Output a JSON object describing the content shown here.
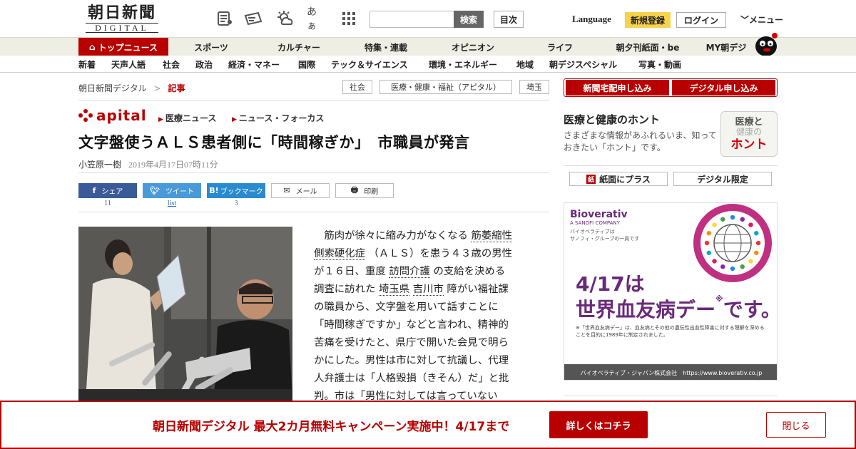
{
  "header": {
    "logo_kanji": "朝日新聞",
    "logo_sub": "DIGITAL",
    "search_placeholder": "",
    "search_button": "検索",
    "toc_button": "目次",
    "language": "Language",
    "register": "新規登録",
    "login": "ログイン",
    "menu": "メニュー",
    "font_size_glyph": "あぁ"
  },
  "nav_main": [
    "トップニュース",
    "スポーツ",
    "カルチャー",
    "特集・連載",
    "オピニオン",
    "ライフ",
    "朝夕刊紙面・be",
    "MY朝デジ"
  ],
  "nav_sub": [
    "新着",
    "天声人語",
    "社会",
    "政治",
    "経済・マネー",
    "国際",
    "テック＆サイエンス",
    "環境・エネルギー",
    "地域",
    "朝デジスペシャル",
    "写真・動画"
  ],
  "breadcrumb": {
    "home": "朝日新聞デジタル",
    "sep": ">",
    "current": "記事"
  },
  "tags": [
    "社会",
    "医療・健康・福祉（アピタル）",
    "埼玉"
  ],
  "article": {
    "brand": "apital",
    "categories": [
      "医療ニュース",
      "ニュース・フォーカス"
    ],
    "headline": "文字盤使うＡＬＳ患者側に「時間稼ぎか」　市職員が発言",
    "author": "小笠原一樹",
    "date": "2019年4月17日07時11分",
    "share": {
      "facebook": "シェア",
      "facebook_count": "11",
      "twitter": "ツイート",
      "twitter_count": "list",
      "hatena": "ブックマーク",
      "hatena_count": "3",
      "mail": "メール",
      "print": "印刷"
    },
    "body_lines": [
      [
        "　筋肉が徐々に縮み力がなくなる ",
        {
          "link": "筋萎縮性"
        }
      ],
      [
        {
          "link": "側索硬化症"
        },
        " （ＡＬＳ）を患う４３歳の男性"
      ],
      [
        "が１６日、重度 ",
        {
          "link": "訪問介護"
        },
        " の支給を決める"
      ],
      [
        "調査に訪れた ",
        {
          "link": "埼玉県"
        },
        " ",
        {
          "link": "吉川市"
        },
        " 障がい福祉課"
      ],
      [
        "の職員から、文字盤を用いて話すことに"
      ],
      [
        "「時間稼ぎですか」などと言われ、精神的"
      ],
      [
        "苦痛を受けたと、県庁で開いた会見で明ら"
      ],
      [
        "かにした。男性は市に対して抗議し、代理"
      ],
      [
        "人弁護士は「人格毀損（きそん）だ」と批"
      ],
      [
        "判。市は「男性に対しては言っていない"
      ]
    ]
  },
  "sidebar": {
    "btn_home_delivery": "新聞宅配申し込み",
    "btn_digital": "デジタル申し込み",
    "hontou_title": "医療と健康のホント",
    "hontou_desc": "さまざまな情報があふれるいま、知っておきたい「ホント」です。",
    "hontou_logo_1": "医療と",
    "hontou_logo_2": "健康の",
    "hontou_logo_3": "ホント",
    "btn_paper_plus": "紙面にプラス",
    "btn_digital_only": "デジタル限定"
  },
  "ad": {
    "brand": "Bioverativ",
    "brand_sub": "A SANOFI COMPANY",
    "brand_note": "バイオベラティブは\nサノフィ・グループの一員です",
    "ring_text": "WORLD HEMOPHILIA DAY ・ APRIL 17",
    "main_1": "4/17は",
    "main_2": "世界血友病デー",
    "main_mark": "※",
    "main_3": "です。",
    "note": "※「世界血友病デー」は、血友病とその他の遺伝性出血性障害に対する理解を深めることを目的に1989年に制定されました。",
    "footer": "バイオベラティブ・ジャパン株式会社　https://www.bioverativ.co.jp"
  },
  "banner": {
    "text": "朝日新聞デジタル 最大2カ月無料キャンペーン実施中！4/17まで",
    "cta": "詳しくはコチラ",
    "close": "閉じる"
  },
  "colors": {
    "brand_red": "#b80000",
    "nav_bg": "#eeeee4",
    "register_yellow": "#f8d24a"
  }
}
